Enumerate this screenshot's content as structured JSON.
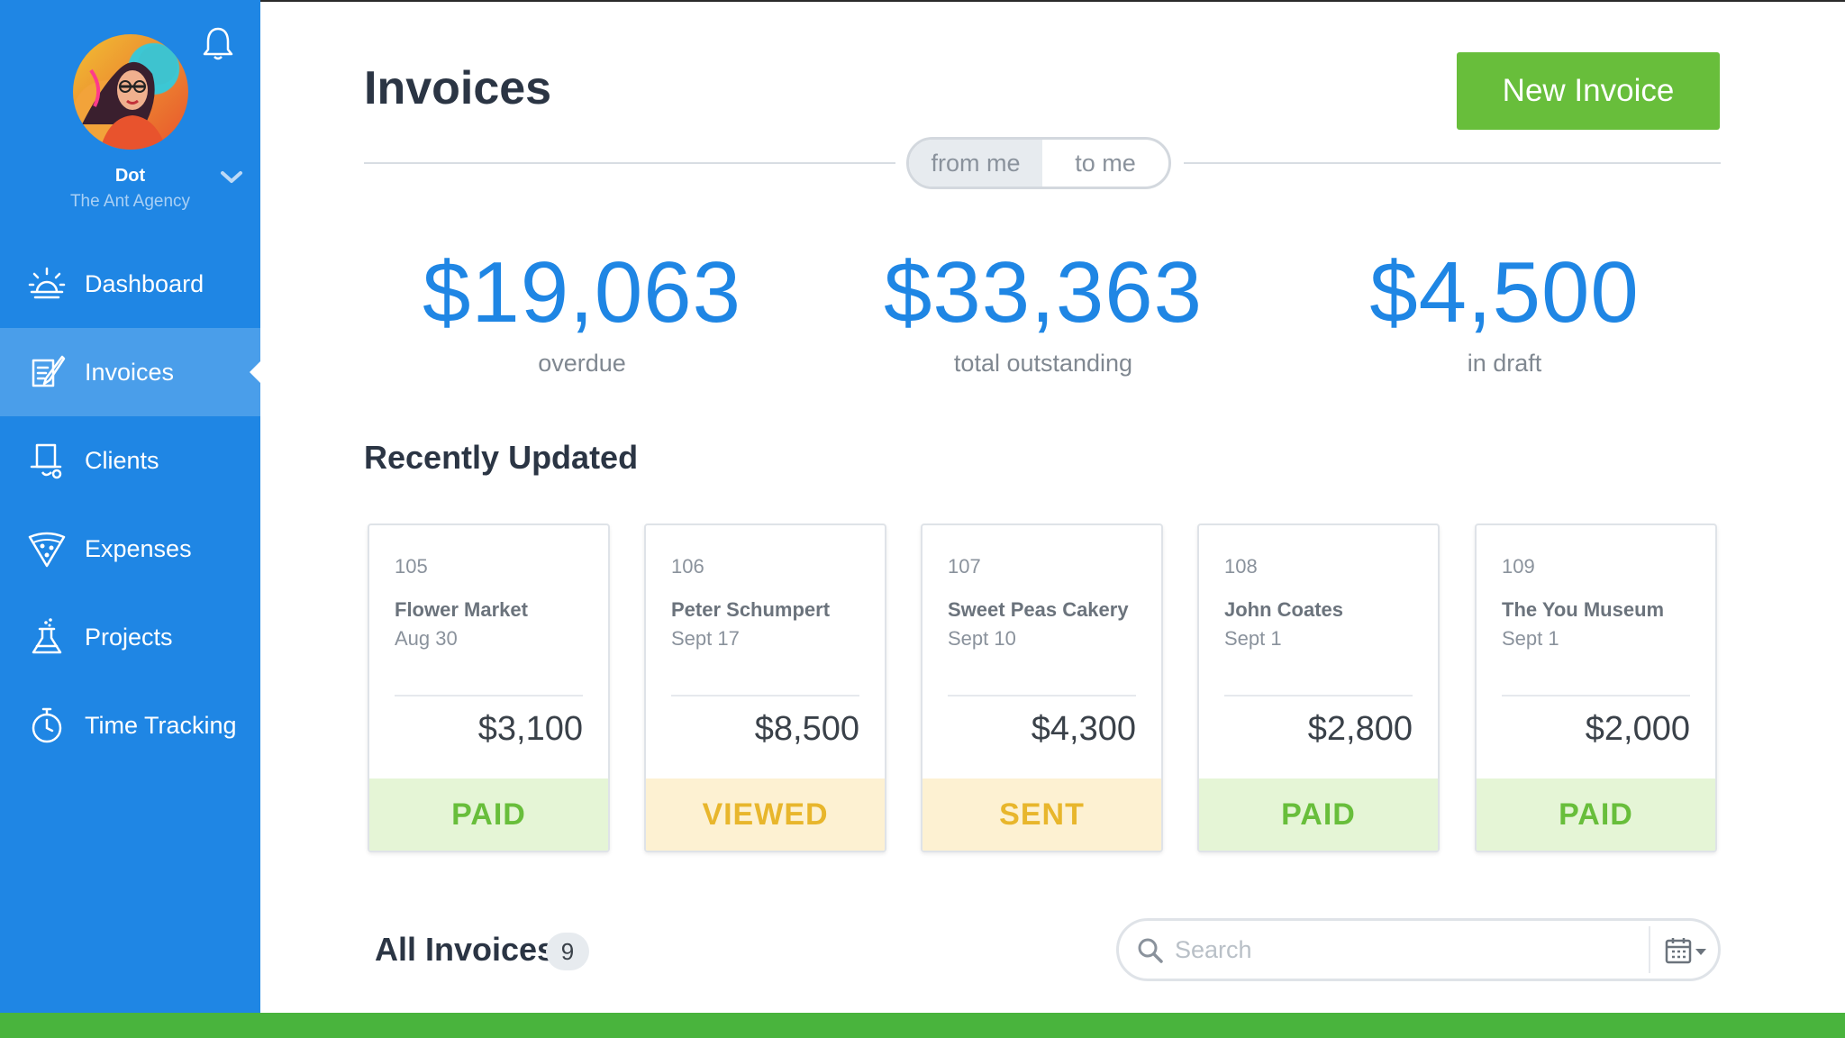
{
  "sidebar": {
    "user": {
      "name": "Dot",
      "organization": "The Ant Agency"
    },
    "items": [
      {
        "label": "Dashboard",
        "icon": "sunrise-icon",
        "active": false
      },
      {
        "label": "Invoices",
        "icon": "invoice-quill-icon",
        "active": true
      },
      {
        "label": "Clients",
        "icon": "client-hat-icon",
        "active": false
      },
      {
        "label": "Expenses",
        "icon": "expenses-pizza-icon",
        "active": false
      },
      {
        "label": "Projects",
        "icon": "projects-flask-icon",
        "active": false
      },
      {
        "label": "Time Tracking",
        "icon": "stopwatch-icon",
        "active": false
      }
    ]
  },
  "header": {
    "title": "Invoices",
    "new_invoice_label": "New Invoice",
    "toggle": {
      "from_me": "from me",
      "to_me": "to me",
      "selected": "from me"
    }
  },
  "summary": [
    {
      "amount": "$19,063",
      "label": "overdue"
    },
    {
      "amount": "$33,363",
      "label": "total outstanding"
    },
    {
      "amount": "$4,500",
      "label": "in draft"
    }
  ],
  "recent": {
    "title": "Recently Updated",
    "cards": [
      {
        "number": "105",
        "client": "Flower Market",
        "date": "Aug 30",
        "amount": "$3,100",
        "status": "PAID"
      },
      {
        "number": "106",
        "client": "Peter Schumpert",
        "date": "Sept 17",
        "amount": "$8,500",
        "status": "VIEWED"
      },
      {
        "number": "107",
        "client": "Sweet Peas Cakery",
        "date": "Sept 10",
        "amount": "$4,300",
        "status": "SENT"
      },
      {
        "number": "108",
        "client": "John Coates",
        "date": "Sept 1",
        "amount": "$2,800",
        "status": "PAID"
      },
      {
        "number": "109",
        "client": "The You Museum",
        "date": "Sept 1",
        "amount": "$2,000",
        "status": "PAID"
      }
    ]
  },
  "all_invoices": {
    "title": "All Invoices",
    "count": "9",
    "search_placeholder": "Search"
  },
  "colors": {
    "sidebar": "#1f86e4",
    "accent_blue": "#1f86e4",
    "brand_green": "#68be3b",
    "paid_bg": "#e5f5d6",
    "pending_bg": "#fdf1d2",
    "pending_text": "#e8b62c"
  }
}
